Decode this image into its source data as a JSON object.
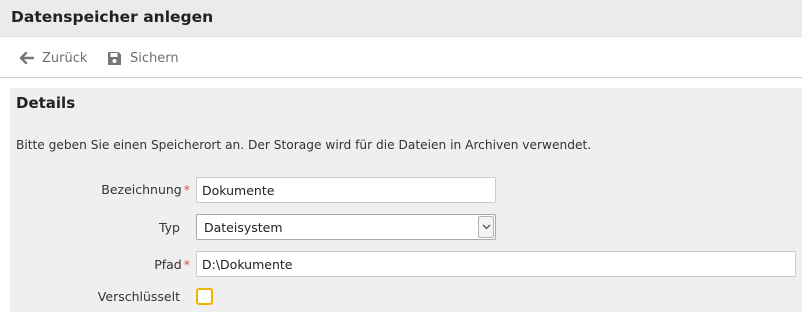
{
  "header": {
    "title": "Datenspeicher anlegen"
  },
  "toolbar": {
    "back_label": "Zurück",
    "back_icon": "arrow-left-icon",
    "save_label": "Sichern",
    "save_icon": "floppy-disk-icon"
  },
  "details": {
    "title": "Details",
    "description": "Bitte geben Sie einen Speicherort an. Der Storage wird für die Dateien in Archiven verwendet.",
    "fields": {
      "name": {
        "label": "Bezeichnung",
        "required": "*",
        "value": "Dokumente"
      },
      "type": {
        "label": "Typ",
        "value": "Dateisystem"
      },
      "path": {
        "label": "Pfad",
        "required": "*",
        "value": "D:\\Dokumente"
      },
      "encrypted": {
        "label": "Verschlüsselt",
        "checked": false
      }
    }
  },
  "colors": {
    "required_star": "#d9534f",
    "checkbox_border": "#f0b400",
    "panel_bg": "#efefef"
  }
}
